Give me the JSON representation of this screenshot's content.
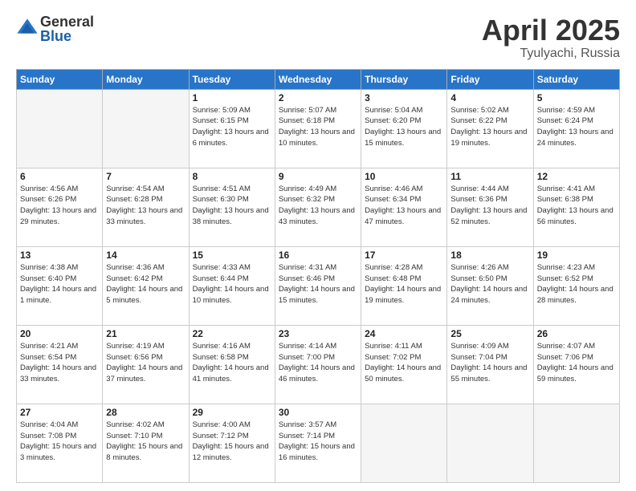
{
  "logo": {
    "general": "General",
    "blue": "Blue"
  },
  "header": {
    "month": "April 2025",
    "location": "Tyulyachi, Russia"
  },
  "days_of_week": [
    "Sunday",
    "Monday",
    "Tuesday",
    "Wednesday",
    "Thursday",
    "Friday",
    "Saturday"
  ],
  "weeks": [
    [
      {
        "day": "",
        "empty": true
      },
      {
        "day": "",
        "empty": true
      },
      {
        "day": "1",
        "sunrise": "5:09 AM",
        "sunset": "6:15 PM",
        "daylight": "13 hours and 6 minutes."
      },
      {
        "day": "2",
        "sunrise": "5:07 AM",
        "sunset": "6:18 PM",
        "daylight": "13 hours and 10 minutes."
      },
      {
        "day": "3",
        "sunrise": "5:04 AM",
        "sunset": "6:20 PM",
        "daylight": "13 hours and 15 minutes."
      },
      {
        "day": "4",
        "sunrise": "5:02 AM",
        "sunset": "6:22 PM",
        "daylight": "13 hours and 19 minutes."
      },
      {
        "day": "5",
        "sunrise": "4:59 AM",
        "sunset": "6:24 PM",
        "daylight": "13 hours and 24 minutes."
      }
    ],
    [
      {
        "day": "6",
        "sunrise": "4:56 AM",
        "sunset": "6:26 PM",
        "daylight": "13 hours and 29 minutes."
      },
      {
        "day": "7",
        "sunrise": "4:54 AM",
        "sunset": "6:28 PM",
        "daylight": "13 hours and 33 minutes."
      },
      {
        "day": "8",
        "sunrise": "4:51 AM",
        "sunset": "6:30 PM",
        "daylight": "13 hours and 38 minutes."
      },
      {
        "day": "9",
        "sunrise": "4:49 AM",
        "sunset": "6:32 PM",
        "daylight": "13 hours and 43 minutes."
      },
      {
        "day": "10",
        "sunrise": "4:46 AM",
        "sunset": "6:34 PM",
        "daylight": "13 hours and 47 minutes."
      },
      {
        "day": "11",
        "sunrise": "4:44 AM",
        "sunset": "6:36 PM",
        "daylight": "13 hours and 52 minutes."
      },
      {
        "day": "12",
        "sunrise": "4:41 AM",
        "sunset": "6:38 PM",
        "daylight": "13 hours and 56 minutes."
      }
    ],
    [
      {
        "day": "13",
        "sunrise": "4:38 AM",
        "sunset": "6:40 PM",
        "daylight": "14 hours and 1 minute."
      },
      {
        "day": "14",
        "sunrise": "4:36 AM",
        "sunset": "6:42 PM",
        "daylight": "14 hours and 5 minutes."
      },
      {
        "day": "15",
        "sunrise": "4:33 AM",
        "sunset": "6:44 PM",
        "daylight": "14 hours and 10 minutes."
      },
      {
        "day": "16",
        "sunrise": "4:31 AM",
        "sunset": "6:46 PM",
        "daylight": "14 hours and 15 minutes."
      },
      {
        "day": "17",
        "sunrise": "4:28 AM",
        "sunset": "6:48 PM",
        "daylight": "14 hours and 19 minutes."
      },
      {
        "day": "18",
        "sunrise": "4:26 AM",
        "sunset": "6:50 PM",
        "daylight": "14 hours and 24 minutes."
      },
      {
        "day": "19",
        "sunrise": "4:23 AM",
        "sunset": "6:52 PM",
        "daylight": "14 hours and 28 minutes."
      }
    ],
    [
      {
        "day": "20",
        "sunrise": "4:21 AM",
        "sunset": "6:54 PM",
        "daylight": "14 hours and 33 minutes."
      },
      {
        "day": "21",
        "sunrise": "4:19 AM",
        "sunset": "6:56 PM",
        "daylight": "14 hours and 37 minutes."
      },
      {
        "day": "22",
        "sunrise": "4:16 AM",
        "sunset": "6:58 PM",
        "daylight": "14 hours and 41 minutes."
      },
      {
        "day": "23",
        "sunrise": "4:14 AM",
        "sunset": "7:00 PM",
        "daylight": "14 hours and 46 minutes."
      },
      {
        "day": "24",
        "sunrise": "4:11 AM",
        "sunset": "7:02 PM",
        "daylight": "14 hours and 50 minutes."
      },
      {
        "day": "25",
        "sunrise": "4:09 AM",
        "sunset": "7:04 PM",
        "daylight": "14 hours and 55 minutes."
      },
      {
        "day": "26",
        "sunrise": "4:07 AM",
        "sunset": "7:06 PM",
        "daylight": "14 hours and 59 minutes."
      }
    ],
    [
      {
        "day": "27",
        "sunrise": "4:04 AM",
        "sunset": "7:08 PM",
        "daylight": "15 hours and 3 minutes."
      },
      {
        "day": "28",
        "sunrise": "4:02 AM",
        "sunset": "7:10 PM",
        "daylight": "15 hours and 8 minutes."
      },
      {
        "day": "29",
        "sunrise": "4:00 AM",
        "sunset": "7:12 PM",
        "daylight": "15 hours and 12 minutes."
      },
      {
        "day": "30",
        "sunrise": "3:57 AM",
        "sunset": "7:14 PM",
        "daylight": "15 hours and 16 minutes."
      },
      {
        "day": "",
        "empty": true
      },
      {
        "day": "",
        "empty": true
      },
      {
        "day": "",
        "empty": true
      }
    ]
  ]
}
